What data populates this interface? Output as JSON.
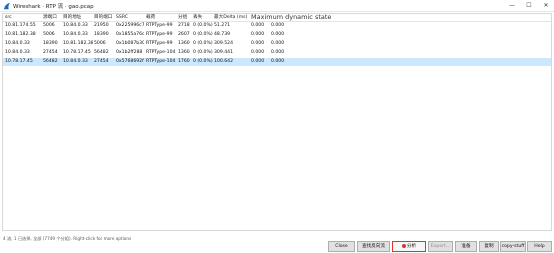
{
  "window": {
    "title": "Wireshark · RTP 流 · gao.pcap",
    "minimize": "—",
    "maximize": "☐",
    "close": "✕"
  },
  "columns": [
    {
      "label": "src",
      "wide": false
    },
    {
      "label": "源端口",
      "wide": false
    },
    {
      "label": "目的地址",
      "wide": false
    },
    {
      "label": "目的端口",
      "wide": false
    },
    {
      "label": "SSRC",
      "wide": false
    },
    {
      "label": "载荷",
      "wide": false
    },
    {
      "label": "分组",
      "wide": false
    },
    {
      "label": "丢失",
      "wide": false
    },
    {
      "label": "最大Delta (ms)",
      "wide": false
    },
    {
      "label": "Maximum dynamic state",
      "wide": true
    }
  ],
  "rows": [
    {
      "cells": [
        "10.81.174.55",
        "5006",
        "10.84.0.33",
        "21950",
        "0x225996c7",
        "RTPType-99",
        "2718",
        "0 (0.0%)",
        "51.271",
        "0.000",
        "0.000"
      ],
      "selected": false
    },
    {
      "cells": [
        "10.81.182.38",
        "5006",
        "10.84.0.33",
        "18390",
        "0x1855a76c",
        "RTPType-99",
        "2607",
        "0 (0.0%)",
        "48.739",
        "0.000",
        "0.000"
      ],
      "selected": false
    },
    {
      "cells": [
        "10.84.0.33",
        "18390",
        "10.81.182.38",
        "5006",
        "0x1b087b30",
        "RTPType-99",
        "1360",
        "0 (0.0%)",
        "309.524",
        "0.000",
        "0.000"
      ],
      "selected": false
    },
    {
      "cells": [
        "10.84.0.33",
        "27454",
        "10.78.17.45",
        "56482",
        "0x1b2ff288",
        "RTPType-104",
        "1360",
        "0 (0.0%)",
        "309.441",
        "0.000",
        "0.000"
      ],
      "selected": false
    },
    {
      "cells": [
        "10.78.17.45",
        "56482",
        "10.84.0.33",
        "27454",
        "0x5768692f",
        "RTPType-104",
        "1760",
        "0 (0.0%)",
        "100.642",
        "0.000",
        "0.000"
      ],
      "selected": true
    }
  ],
  "status": "4 流, 1 已选择, 全部 (7749 个分组). Right-click for more options",
  "buttons": {
    "close": "Close",
    "find_reverse": "查找反向流",
    "analyze": "分析",
    "export": "Export...",
    "prepare_filter": "准备",
    "copy": "复制",
    "copy_more": "copy-stuff",
    "help": "Help"
  }
}
